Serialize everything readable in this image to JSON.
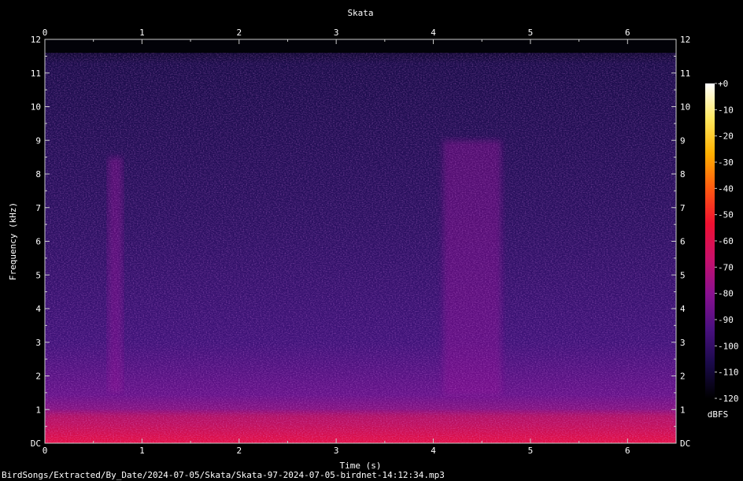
{
  "chart_data": {
    "type": "heatmap",
    "title": "Skata",
    "xlabel": "Time (s)",
    "ylabel": "Frequency (kHz)",
    "xlim": [
      0,
      6.5
    ],
    "ylim": [
      0,
      12
    ],
    "x_ticks": [
      "0",
      "1",
      "2",
      "3",
      "4",
      "5",
      "6"
    ],
    "y_ticks": [
      "DC",
      "1",
      "2",
      "3",
      "4",
      "5",
      "6",
      "7",
      "8",
      "9",
      "10",
      "11",
      "12"
    ],
    "colorbar": {
      "label": "dBFS",
      "range": [
        -120,
        0
      ],
      "ticks": [
        "+0",
        "-10",
        "-20",
        "-30",
        "-40",
        "-50",
        "-60",
        "-70",
        "-80",
        "-90",
        "-100",
        "-110",
        "-120"
      ],
      "colors": [
        "#000000",
        "#1a0a4a",
        "#4a1080",
        "#8a1090",
        "#c8106a",
        "#f01030",
        "#ff5a10",
        "#ffb000",
        "#ffe860",
        "#ffffff"
      ]
    },
    "spectral_content_upper_khz": 11.6,
    "events": [
      {
        "t_start": 0.65,
        "t_end": 0.8,
        "f_low": 1.5,
        "f_high": 8.5,
        "level_dbfs": -80
      },
      {
        "t_start": 4.1,
        "t_end": 4.7,
        "f_low": 1.4,
        "f_high": 9.0,
        "level_dbfs": -78
      }
    ],
    "background_level_dbfs": -100,
    "low_freq_level_dbfs": -60
  },
  "footer": {
    "filename": "BirdSongs/Extracted/By_Date/2024-07-05/Skata/Skata-97-2024-07-05-birdnet-14:12:34.mp3"
  }
}
